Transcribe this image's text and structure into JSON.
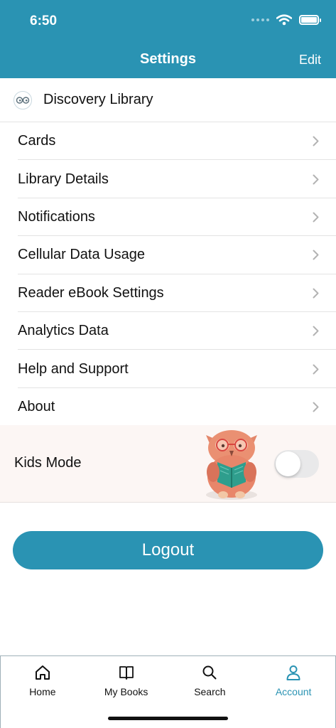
{
  "status_bar": {
    "time": "6:50"
  },
  "header": {
    "title": "Settings",
    "edit_label": "Edit"
  },
  "library": {
    "name": "Discovery Library"
  },
  "menu": [
    {
      "label": "Cards"
    },
    {
      "label": "Library Details"
    },
    {
      "label": "Notifications"
    },
    {
      "label": "Cellular Data Usage"
    },
    {
      "label": "Reader eBook Settings"
    },
    {
      "label": "Analytics Data"
    },
    {
      "label": "Help and Support"
    },
    {
      "label": "About"
    }
  ],
  "kids_mode": {
    "label": "Kids Mode",
    "enabled": false
  },
  "logout": {
    "label": "Logout"
  },
  "tabs": [
    {
      "label": "Home",
      "icon": "home-icon",
      "active": false
    },
    {
      "label": "My Books",
      "icon": "book-icon",
      "active": false
    },
    {
      "label": "Search",
      "icon": "search-icon",
      "active": false
    },
    {
      "label": "Account",
      "icon": "person-icon",
      "active": true
    }
  ],
  "colors": {
    "accent": "#2a93b3",
    "kids_background": "#fcf6f4",
    "toggle_off": "#e9e9ea"
  }
}
